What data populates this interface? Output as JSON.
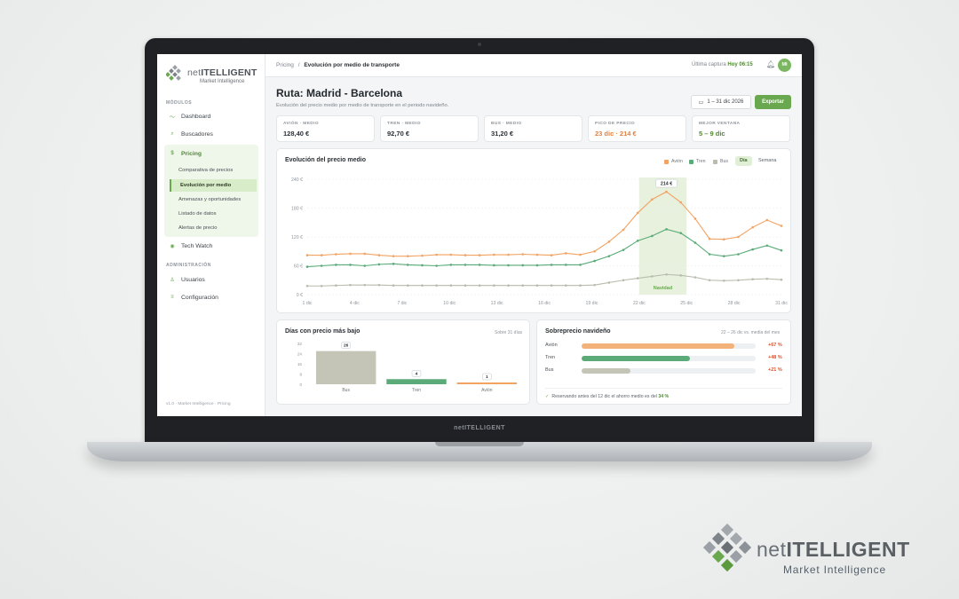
{
  "brand": {
    "name_prefix": "net",
    "name_main": "ITELLIGENT",
    "tagline": "Market Intelligence",
    "lid_label": "netITELLIGENT"
  },
  "sidebar": {
    "section_modules": "MÓDULOS",
    "items": [
      {
        "label": "Dashboard",
        "icon": "trend-icon"
      },
      {
        "label": "Buscadores",
        "icon": "search-icon"
      },
      {
        "label": "Pricing",
        "icon": "dollar-icon"
      },
      {
        "label": "Tech Watch",
        "icon": "eye-icon"
      }
    ],
    "pricing_sub": [
      "Comparativa de precios",
      "Evolución por medio",
      "Amenazas y oportunidades",
      "Listado de datos",
      "Alertas de precio"
    ],
    "section_admin": "ADMINISTRACIÓN",
    "admin_items": [
      {
        "label": "Usuarios",
        "icon": "user-icon"
      },
      {
        "label": "Configuración",
        "icon": "settings-icon"
      }
    ],
    "footer": "v1.0 · Market Intelligence · Pricing"
  },
  "topbar": {
    "crumb_root": "Pricing",
    "crumb_sep": "/",
    "crumb_current": "Evolución por medio de transporte",
    "capture_label": "Última captura",
    "capture_time": "Hoy 06:15",
    "avatar": "MI"
  },
  "page": {
    "title": "Ruta: Madrid - Barcelona",
    "subtitle": "Evolución del precio medio por medio de transporte en el periodo navideño.",
    "date_range": "1 – 31 dic 2026",
    "export_label": "Exportar"
  },
  "kpis": [
    {
      "label": "AVIÓN · MEDIO",
      "value": "128,40 €"
    },
    {
      "label": "TREN · MEDIO",
      "value": "92,70 €"
    },
    {
      "label": "BUS · MEDIO",
      "value": "31,20 €"
    },
    {
      "label": "PICO DE PRECIO",
      "value": "23 dic · 214 €"
    },
    {
      "label": "MEJOR VENTANA",
      "value": "5 – 9 dic"
    }
  ],
  "line_card": {
    "title": "Evolución del precio medio",
    "legend": [
      "Avión",
      "Tren",
      "Bus"
    ],
    "toggle_day": "Día",
    "toggle_week": "Semana",
    "highlight_label": "Navidad",
    "peak_label": "214 €"
  },
  "chart_data": [
    {
      "type": "line",
      "title": "Evolución del precio medio",
      "x": [
        "1 dic",
        "2 dic",
        "3 dic",
        "4 dic",
        "5 dic",
        "6 dic",
        "7 dic",
        "8 dic",
        "9 dic",
        "10 dic",
        "11 dic",
        "12 dic",
        "13 dic",
        "14 dic",
        "15 dic",
        "16 dic",
        "17 dic",
        "18 dic",
        "19 dic",
        "20 dic",
        "21 dic",
        "22 dic",
        "23 dic",
        "24 dic",
        "25 dic",
        "26 dic",
        "27 dic",
        "28 dic",
        "29 dic",
        "30 dic",
        "31 dic"
      ],
      "x_tick_labels": [
        "1 dic",
        "4 dic",
        "7 dic",
        "10 dic",
        "13 dic",
        "16 dic",
        "19 dic",
        "22 dic",
        "25 dic",
        "28 dic",
        "31 dic"
      ],
      "y_ticks": [
        "0 €",
        "60 €",
        "120 €",
        "180 €",
        "240 €"
      ],
      "ylim": [
        0,
        240
      ],
      "highlight_range": [
        "22 dic",
        "25 dic"
      ],
      "series": [
        {
          "name": "Avión",
          "color": "#f2a261",
          "values": [
            82,
            82,
            84,
            85,
            85,
            82,
            80,
            80,
            81,
            83,
            83,
            82,
            82,
            83,
            83,
            84,
            83,
            82,
            86,
            83,
            90,
            110,
            135,
            170,
            198,
            214,
            192,
            158,
            116,
            115,
            120,
            140,
            155,
            143
          ]
        },
        {
          "name": "Tren",
          "color": "#5aab78",
          "values": [
            58,
            60,
            62,
            62,
            60,
            63,
            64,
            62,
            61,
            60,
            62,
            62,
            62,
            61,
            61,
            61,
            61,
            62,
            62,
            62,
            70,
            80,
            93,
            112,
            122,
            136,
            128,
            108,
            84,
            80,
            84,
            94,
            102,
            92
          ]
        },
        {
          "name": "Bus",
          "color": "#b8bcad",
          "values": [
            18,
            18,
            19,
            20,
            20,
            20,
            19,
            19,
            19,
            19,
            19,
            19,
            19,
            19,
            19,
            19,
            19,
            19,
            19,
            19,
            20,
            25,
            30,
            34,
            38,
            42,
            40,
            36,
            30,
            29,
            30,
            32,
            33,
            31
          ]
        }
      ]
    },
    {
      "type": "bar",
      "title": "Días con precio más bajo",
      "categories": [
        "Bus",
        "Tren",
        "Avión"
      ],
      "values": [
        26,
        4,
        1
      ],
      "colors": [
        "#c4c5b6",
        "#5aab78",
        "#f2a261"
      ],
      "y_ticks": [
        "0",
        "8",
        "16",
        "24",
        "32"
      ],
      "ylim": [
        0,
        32
      ]
    },
    {
      "type": "bar",
      "title": "Sobreprecio navideño",
      "categories": [
        "Avión",
        "Tren",
        "Bus"
      ],
      "values": [
        67,
        48,
        21
      ],
      "colors": [
        "#f2b27a",
        "#5aab78",
        "#c4c5b6"
      ]
    }
  ],
  "days_card": {
    "title": "Días con precio más bajo",
    "note": "Sobre 31 días"
  },
  "surcharge_card": {
    "title": "Sobreprecio navideño",
    "note": "22 – 26 dic vs. media del mes",
    "rows": [
      {
        "label": "Avión",
        "pct": "+67 %",
        "fill": 0.88
      },
      {
        "label": "Tren",
        "pct": "+48 %",
        "fill": 0.62
      },
      {
        "label": "Bus",
        "pct": "+21 %",
        "fill": 0.28
      }
    ],
    "footer_text": "Reservando antes del 12 dic el ahorro medio es del",
    "footer_value": "34 %"
  }
}
